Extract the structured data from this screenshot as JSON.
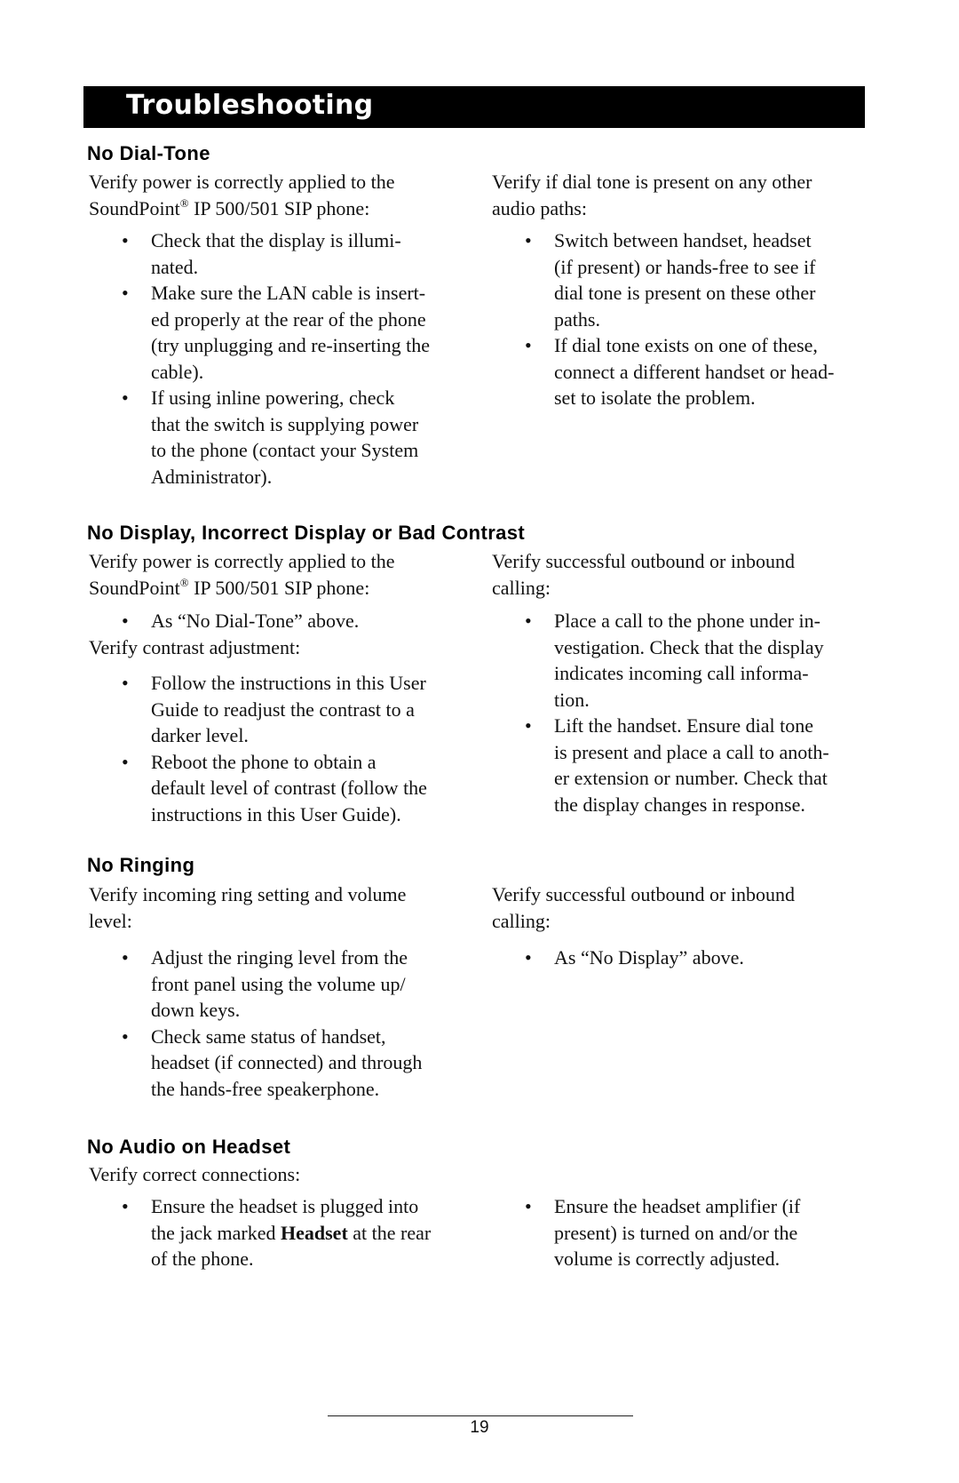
{
  "page": {
    "title": "Troubleshooting",
    "page_number": "19"
  },
  "sections": [
    {
      "heading": "No Dial-Tone",
      "left": {
        "intro_lines": [
          "Verify power is correctly applied to the",
          "SoundPoint",
          "®",
          " IP 500/501 SIP phone:"
        ],
        "bullets": [
          [
            "Check that the display is illumi-",
            "nated."
          ],
          [
            "Make sure the LAN cable is insert-",
            "ed properly at the rear of the phone",
            "(try unplugging and re-inserting the",
            "cable)."
          ],
          [
            "If using inline powering, check",
            "that the switch is supplying power",
            "to the phone (contact your System",
            "Administrator)."
          ]
        ]
      },
      "right": {
        "intro_lines": [
          "Verify if dial tone is present on any other",
          "audio paths:"
        ],
        "bullets": [
          [
            "Switch between handset, headset",
            "(if present) or hands-free to see if",
            "dial tone is present on these other",
            "paths."
          ],
          [
            "If dial tone exists on one of these,",
            "connect a different handset or head-",
            "set to isolate the problem."
          ]
        ]
      }
    },
    {
      "heading": "No Display, Incorrect Display or Bad Contrast",
      "left": {
        "intro_lines": [
          "Verify power is correctly applied to the",
          "SoundPoint",
          "®",
          " IP 500/501 SIP phone:"
        ],
        "bullets": [
          [
            "As “No Dial-Tone” above."
          ]
        ],
        "second_intro": "Verify contrast adjustment:",
        "second_bullets": [
          [
            "Follow the instructions in this User",
            "Guide to readjust the contrast to a",
            "darker level."
          ],
          [
            "Reboot the phone to obtain a",
            "default level of contrast (follow the",
            "instructions in this User Guide)."
          ]
        ]
      },
      "right": {
        "intro_lines": [
          "Verify successful outbound or inbound",
          "calling:"
        ],
        "bullets": [
          [
            "Place a call to the phone under in-",
            "vestigation.  Check that the display",
            "indicates incoming call informa-",
            "tion."
          ],
          [
            "Lift the handset.  Ensure dial tone",
            "is present and place a call to anoth-",
            "er extension or number.  Check that",
            "the display changes in response."
          ]
        ]
      }
    },
    {
      "heading": "No Ringing",
      "left": {
        "intro_lines": [
          "Verify incoming ring setting and volume",
          "level:"
        ],
        "bullets": [
          [
            "Adjust the ringing level from the",
            "front panel using the volume up/",
            "down keys."
          ],
          [
            "Check same status of handset,",
            "headset (if connected) and through",
            "the hands-free speakerphone."
          ]
        ]
      },
      "right": {
        "intro_lines": [
          "Verify successful outbound or inbound",
          "calling:"
        ],
        "bullets": [
          [
            "As “No Display” above."
          ]
        ]
      }
    },
    {
      "heading": "No Audio on Headset",
      "left": {
        "intro_lines": [
          "Verify correct connections:"
        ],
        "bullets": [
          [
            "Ensure the headset is plugged into",
            "the jack marked ",
            "Headset",
            " at the rear",
            "of the phone."
          ]
        ]
      },
      "right": {
        "bullets": [
          [
            "Ensure the headset amplifier (if",
            "present) is turned on and/or the",
            "volume is correctly adjusted."
          ]
        ]
      }
    }
  ],
  "bullet_glyph": "•"
}
